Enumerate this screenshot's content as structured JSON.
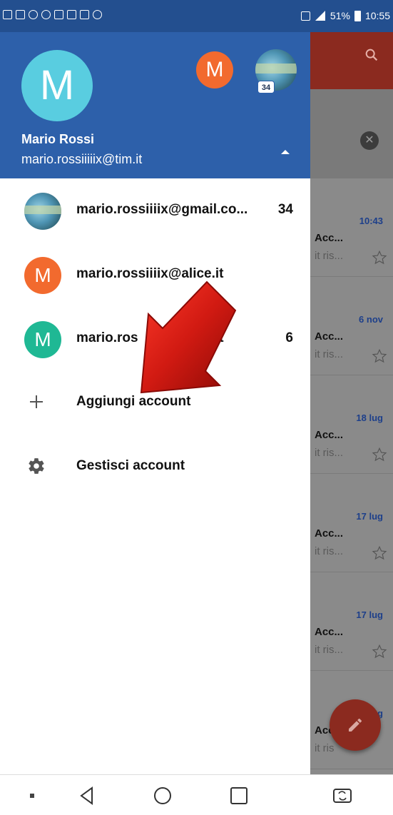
{
  "status_bar": {
    "battery": "51%",
    "time": "10:55"
  },
  "drawer": {
    "current_account": {
      "initial": "M",
      "name": "Mario Rossi",
      "email": "mario.rossiiiiix@tim.it"
    },
    "header_avatars": [
      {
        "initial": "M",
        "color": "#f26a2e"
      },
      {
        "type": "photo",
        "badge": "34"
      }
    ],
    "accounts": [
      {
        "avatar": "photo",
        "email": "mario.rossiiiix@gmail.co...",
        "count": "34"
      },
      {
        "avatar": "M",
        "avatar_color": "#f26a2e",
        "email": "mario.rossiiiix@alice.it",
        "count": ""
      },
      {
        "avatar": "M",
        "avatar_color": "#1fb894",
        "email": "mario.ros",
        "email_tail": "it",
        "count": "6"
      }
    ],
    "actions": [
      {
        "icon": "plus-icon",
        "label": "Aggiungi account"
      },
      {
        "icon": "gear-icon",
        "label": "Gestisci account"
      }
    ]
  },
  "background_list": {
    "items": [
      {
        "time": "10:43",
        "sender": "Acc...",
        "snippet": "it ris..."
      },
      {
        "time": "6 nov",
        "sender": "Acc...",
        "snippet": "it ris..."
      },
      {
        "time": "18 lug",
        "sender": "Acc...",
        "snippet": "it ris..."
      },
      {
        "time": "17 lug",
        "sender": "Acc...",
        "snippet": "it ris..."
      },
      {
        "time": "17 lug",
        "sender": "Acc...",
        "snippet": "it ris..."
      },
      {
        "time": "17 lug",
        "sender": "Acc",
        "snippet": "it ris"
      }
    ]
  },
  "colors": {
    "header_blue": "#2d60aa",
    "status_blue": "#234f8f",
    "accent_red": "#8b2a1f",
    "arrow_red": "#d11a12"
  }
}
